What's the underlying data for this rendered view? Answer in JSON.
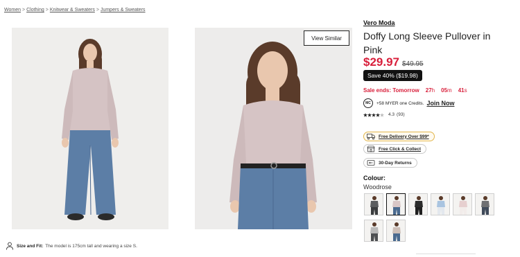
{
  "breadcrumbs": [
    {
      "label": "Women"
    },
    {
      "label": "Clothing"
    },
    {
      "label": "Knitwear & Sweaters"
    },
    {
      "label": "Jumpers & Sweaters"
    }
  ],
  "breadcrumb_separator": ">",
  "gallery": {
    "view_similar_label": "View Similar"
  },
  "size_fit": {
    "label": "Size and Fit:",
    "text": "The model is 175cm tall and wearing a size S."
  },
  "product": {
    "brand": "Vero Moda",
    "title": "Doffy Long Sleeve Pullover in Pink",
    "price": "$29.97",
    "was_price": "$49.95",
    "save_badge": "Save 40% ($19.98)",
    "sale_label": "Sale ends: Tomorrow",
    "countdown": {
      "hours": "27",
      "hours_unit": "h",
      "minutes": "05",
      "minutes_unit": "m",
      "seconds": "41",
      "seconds_unit": "s"
    },
    "credits_icon_text": "MC",
    "credits_text": "+58 MYER one Credits.",
    "join_label": "Join Now",
    "rating_value": "4.3",
    "rating_stars": 4.3,
    "review_count": "(93)"
  },
  "delivery_chips": [
    {
      "label": "Free Delivery Over $99*",
      "icon": "truck-icon"
    },
    {
      "label": "Free Click & Collect",
      "icon": "store-icon"
    },
    {
      "label": "30-Day Returns",
      "icon": "return-icon"
    }
  ],
  "colour": {
    "label": "Colour:",
    "selected": "Woodrose",
    "swatches": [
      {
        "name": "charcoal",
        "top": "#5b5d5f",
        "bottom": "#3a3c3e"
      },
      {
        "name": "woodrose",
        "top": "#d8c6c6",
        "bottom": "#4a6a8f",
        "selected": true
      },
      {
        "name": "black",
        "top": "#2b2b2b",
        "bottom": "#1f1f1f"
      },
      {
        "name": "light-blue",
        "top": "#a9c4e0",
        "bottom": "#e3e8ee"
      },
      {
        "name": "blush",
        "top": "#e6cfcf",
        "bottom": "#f2ecea"
      },
      {
        "name": "grey-marle",
        "top": "#6e6f72",
        "bottom": "#3f4a5a"
      },
      {
        "name": "light-grey",
        "top": "#b9b9b9",
        "bottom": "#4d4f52"
      },
      {
        "name": "taupe",
        "top": "#cdbfb8",
        "bottom": "#4a6a8f"
      }
    ]
  },
  "colors": {
    "accent_red": "#d81e3a",
    "badge_black": "#111111",
    "delivery_border": "#e2b64a"
  }
}
